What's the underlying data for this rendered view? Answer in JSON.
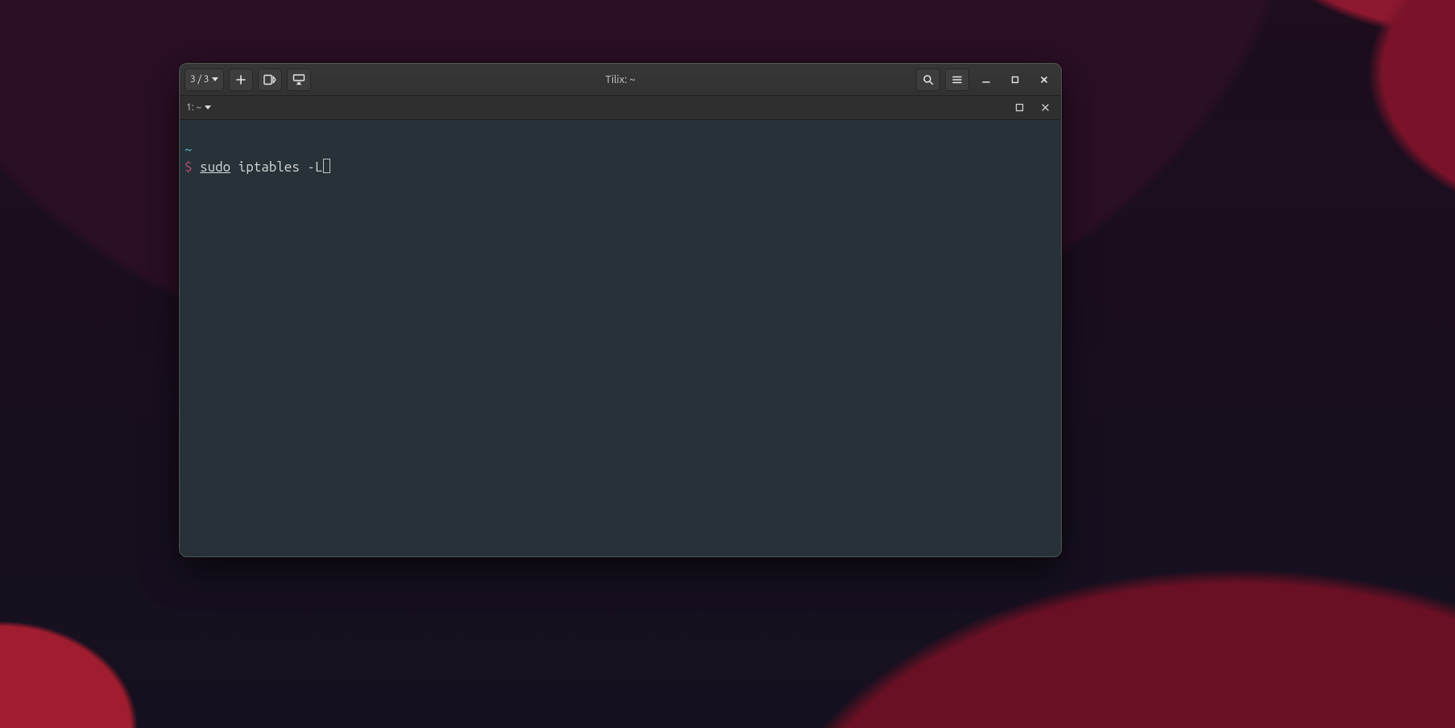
{
  "window": {
    "title": "Tilix: ~"
  },
  "headerbar": {
    "session_indicator": "3 / 3"
  },
  "tabbar": {
    "tab_label": "1: ~"
  },
  "terminal": {
    "cwd_line": "~",
    "prompt_symbol": "$",
    "command_sudo": "sudo",
    "command_rest": " iptables -L"
  }
}
